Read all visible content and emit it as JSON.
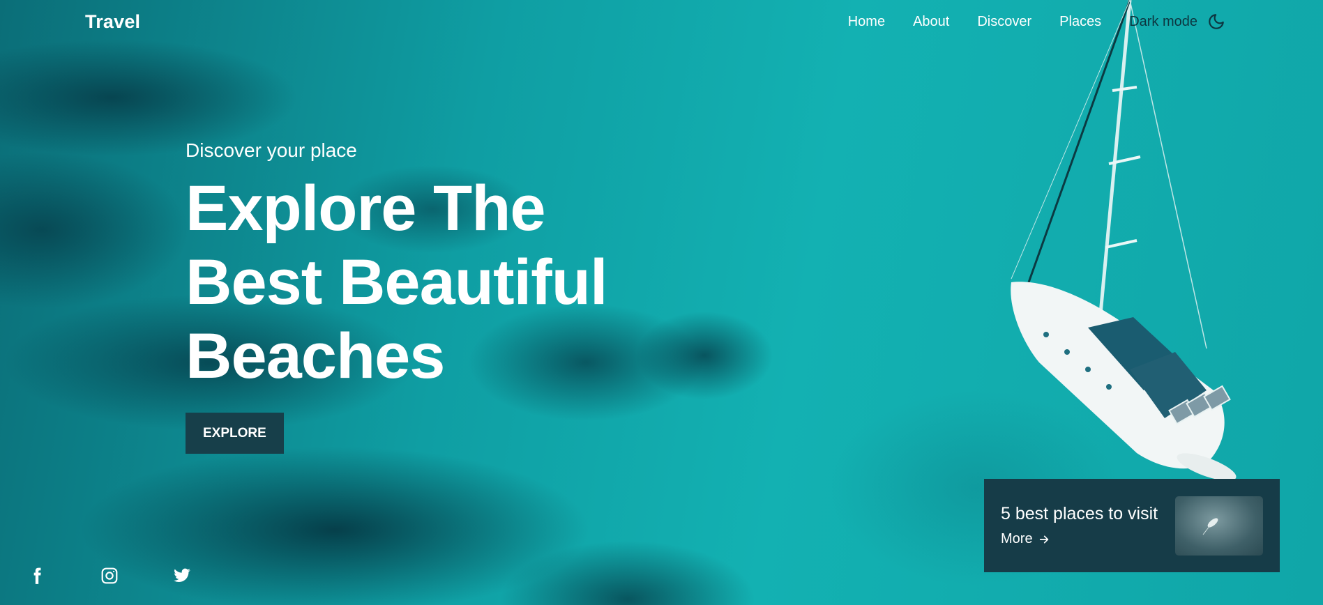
{
  "header": {
    "logo": "Travel",
    "nav": [
      "Home",
      "About",
      "Discover",
      "Places"
    ],
    "dark_mode_label": "Dark mode",
    "dark_mode_icon": "moon-icon"
  },
  "hero": {
    "subtitle": "Discover your place",
    "title_lines": [
      "Explore The",
      "Best Beautiful",
      "Beaches"
    ],
    "button_label": "EXPLORE"
  },
  "socials": [
    "facebook-icon",
    "instagram-icon",
    "twitter-icon"
  ],
  "card": {
    "title": "5 best places to visit",
    "more_label": "More",
    "more_icon": "arrow-right-icon"
  },
  "colors": {
    "ocean": "#10a6a8",
    "dark_panel": "#163c48",
    "button": "#173f4a",
    "dark_mode_text": "#0d3640"
  }
}
